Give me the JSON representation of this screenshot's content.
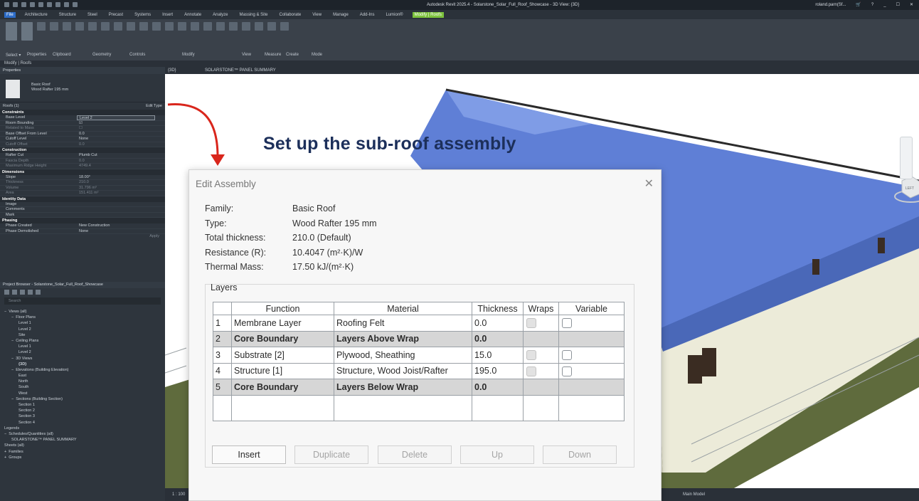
{
  "app": {
    "title": "Autodesk Revit 2025.4 - Solarstone_Solar_Full_Roof_Showcase - 3D View: {3D}",
    "user": "roland.parn(Sf...",
    "window_controls": [
      "_",
      "☐",
      "✕"
    ]
  },
  "ribbon": {
    "tabs": [
      "File",
      "Architecture",
      "Structure",
      "Steel",
      "Precast",
      "Systems",
      "Insert",
      "Annotate",
      "Analyze",
      "Massing & Site",
      "Collaborate",
      "View",
      "Manage",
      "Add-Ins",
      "Lumion®",
      "Modify | Roofs"
    ],
    "panels": [
      "Select ▾",
      "Properties",
      "Clipboard",
      "Geometry",
      "Controls",
      "Modify",
      "View",
      "Measure",
      "Create",
      "Mode"
    ],
    "context": "Modify | Roofs"
  },
  "properties": {
    "header": "Properties",
    "family": "Basic Roof",
    "type": "Wood Rafter 195 mm",
    "instance": "Roofs (1)",
    "edit_type": "Edit Type",
    "sections": [
      {
        "name": "Constraints",
        "rows": [
          {
            "k": "Base Level",
            "v": "Level 2",
            "boxed": true
          },
          {
            "k": "Room Bounding",
            "v": "☑"
          },
          {
            "k": "Related to Mass",
            "v": "☐",
            "dim": true
          },
          {
            "k": "Base Offset From Level",
            "v": "0.0"
          },
          {
            "k": "Cutoff Level",
            "v": "None"
          },
          {
            "k": "Cutoff Offset",
            "v": "0.0",
            "dim": true
          }
        ]
      },
      {
        "name": "Construction",
        "rows": [
          {
            "k": "Rafter Cut",
            "v": "Plumb Cut"
          },
          {
            "k": "Fascia Depth",
            "v": "0.0",
            "dim": true
          },
          {
            "k": "Maximum Ridge Height",
            "v": "4749.4",
            "dim": true
          }
        ]
      },
      {
        "name": "Dimensions",
        "rows": [
          {
            "k": "Slope",
            "v": "18.00°"
          },
          {
            "k": "Thickness",
            "v": "210.0",
            "dim": true
          },
          {
            "k": "Volume",
            "v": "31.796 m³",
            "dim": true
          },
          {
            "k": "Area",
            "v": "151.411 m²",
            "dim": true
          }
        ]
      },
      {
        "name": "Identity Data",
        "rows": [
          {
            "k": "Image",
            "v": ""
          },
          {
            "k": "Comments",
            "v": ""
          },
          {
            "k": "Mark",
            "v": ""
          }
        ]
      },
      {
        "name": "Phasing",
        "rows": [
          {
            "k": "Phase Created",
            "v": "New Construction"
          },
          {
            "k": "Phase Demolished",
            "v": "None"
          }
        ]
      }
    ],
    "apply": "Apply"
  },
  "browser": {
    "header": "Project Browser - Solarstone_Solar_Full_Roof_Showcase",
    "search_placeholder": "Search",
    "tree": [
      {
        "label": "Views (all)",
        "depth": 0,
        "toggle": "−"
      },
      {
        "label": "Floor Plans",
        "depth": 1,
        "toggle": "−"
      },
      {
        "label": "Level 1",
        "depth": 2
      },
      {
        "label": "Level 2",
        "depth": 2
      },
      {
        "label": "Site",
        "depth": 2
      },
      {
        "label": "Ceiling Plans",
        "depth": 1,
        "toggle": "−"
      },
      {
        "label": "Level 1",
        "depth": 2
      },
      {
        "label": "Level 2",
        "depth": 2
      },
      {
        "label": "3D Views",
        "depth": 1,
        "toggle": "−"
      },
      {
        "label": "{3D}",
        "depth": 2,
        "bold": true
      },
      {
        "label": "Elevations (Building Elevation)",
        "depth": 1,
        "toggle": "−"
      },
      {
        "label": "East",
        "depth": 2
      },
      {
        "label": "North",
        "depth": 2
      },
      {
        "label": "South",
        "depth": 2
      },
      {
        "label": "West",
        "depth": 2
      },
      {
        "label": "Sections (Building Section)",
        "depth": 1,
        "toggle": "−"
      },
      {
        "label": "Section 1",
        "depth": 2
      },
      {
        "label": "Section 2",
        "depth": 2
      },
      {
        "label": "Section 3",
        "depth": 2
      },
      {
        "label": "Section 4",
        "depth": 2
      },
      {
        "label": "Legends",
        "depth": 0
      },
      {
        "label": "Schedules/Quantities (all)",
        "depth": 0,
        "toggle": "−"
      },
      {
        "label": "SOLARSTONE™ PANEL SUMMARY",
        "depth": 1
      },
      {
        "label": "Sheets (all)",
        "depth": 0
      },
      {
        "label": "Families",
        "depth": 0,
        "toggle": "+"
      },
      {
        "label": "Groups",
        "depth": 0,
        "toggle": "+"
      }
    ]
  },
  "view_tabs": [
    "{3D}",
    "SOLARSTONE™ PANEL SUMMARY"
  ],
  "view_bar": {
    "scale": "1 : 100",
    "model": "Main Model"
  },
  "annotation": "Set up the sub-roof assembly",
  "dialog": {
    "title": "Edit Assembly",
    "info": [
      {
        "k": "Family:",
        "v": "Basic Roof"
      },
      {
        "k": "Type:",
        "v": "Wood Rafter 195 mm"
      },
      {
        "k": "Total thickness:",
        "v": "210.0 (Default)"
      },
      {
        "k": "Resistance (R):",
        "v": "10.4047 (m²·K)/W"
      },
      {
        "k": "Thermal Mass:",
        "v": "17.50 kJ/(m²·K)"
      }
    ],
    "layers_label": "Layers",
    "columns": [
      "",
      "Function",
      "Material",
      "Thickness",
      "Wraps",
      "Variable"
    ],
    "rows": [
      {
        "n": "1",
        "function": "Membrane Layer",
        "material": "Roofing Felt",
        "thickness": "0.0",
        "core": false
      },
      {
        "n": "2",
        "function": "Core Boundary",
        "material": "Layers Above Wrap",
        "thickness": "0.0",
        "core": true
      },
      {
        "n": "3",
        "function": "Substrate [2]",
        "material": "Plywood, Sheathing",
        "thickness": "15.0",
        "core": false
      },
      {
        "n": "4",
        "function": "Structure [1]",
        "material": "Structure, Wood Joist/Rafter",
        "thickness": "195.0",
        "core": false
      },
      {
        "n": "5",
        "function": "Core Boundary",
        "material": "Layers Below Wrap",
        "thickness": "0.0",
        "core": true
      }
    ],
    "buttons": {
      "insert": "Insert",
      "duplicate": "Duplicate",
      "delete": "Delete",
      "up": "Up",
      "down": "Down"
    },
    "close": "✕"
  },
  "viewcube_label": "LEFT",
  "colors": {
    "accent_blue": "#2d6cc7",
    "context_tab": "#7cc23c",
    "arrow": "#d9261c",
    "roof": "#5f7fd6"
  }
}
